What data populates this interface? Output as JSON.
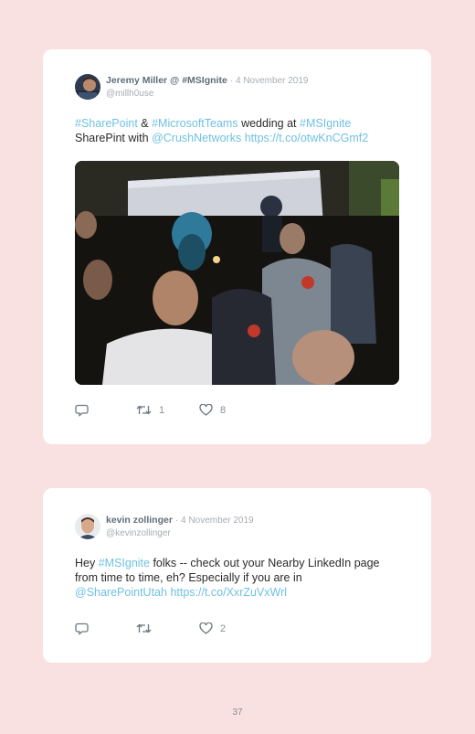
{
  "tweets": [
    {
      "author": "Jeremy Miller @ #MSIgnite",
      "separator": "·",
      "date": "4 November 2019",
      "handle": "@millh0use",
      "text_parts": [
        "#SharePoint",
        " & ",
        "#MicrosoftTeams",
        " wedding at ",
        "#MSIgnite",
        "SharePint with ",
        "@CrushNetworks",
        " ",
        "https://t.co/otwKnCGmf2"
      ],
      "has_photo": true,
      "retweets": "1",
      "likes": "8"
    },
    {
      "author": "kevin zollinger",
      "separator": "·",
      "date": "4 November 2019",
      "handle": "@kevinzollinger",
      "text_parts": [
        "Hey ",
        "#MSIgnite",
        " folks -- check out your Nearby LinkedIn page",
        "from time to time, eh? Especially if you are in",
        "@SharePointUtah",
        " ",
        "https://t.co/XxrZuVxWrl"
      ],
      "has_photo": false,
      "retweets": "",
      "likes": "2"
    }
  ],
  "icons": {
    "reply": "reply-icon",
    "retweet": "retweet-icon",
    "like": "heart-icon"
  },
  "colors": {
    "background": "#f9e1e2",
    "card": "#ffffff",
    "link": "#6fc1e2",
    "author": "#5f6d7a",
    "meta": "#a7adb3"
  },
  "page_number": "37"
}
